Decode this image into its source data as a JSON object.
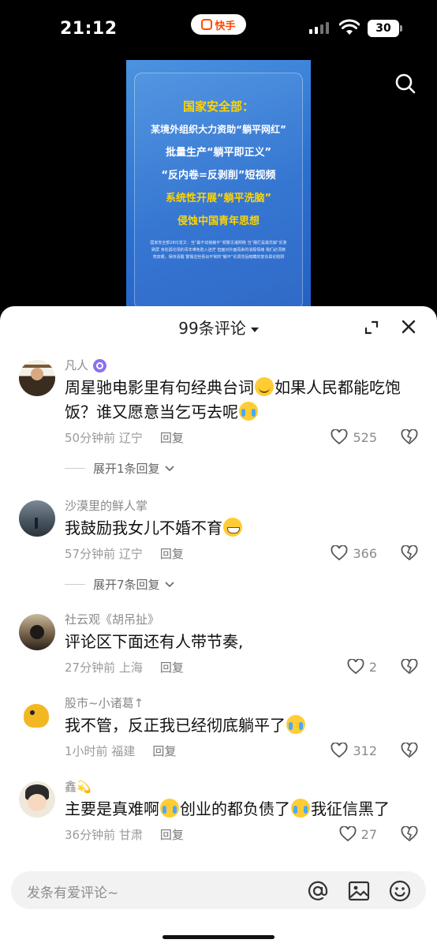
{
  "status_bar": {
    "time": "21:12",
    "app_name": "快手",
    "battery": "30"
  },
  "video": {
    "headline_lines": [
      "国家安全部：",
      "某境外组织大力资助“躺平网红”",
      "批量生产“躺平即正义”",
      "“反内卷=反剥削”短视频",
      "系统性开展“躺平洗脑”",
      "侵蚀中国青年思想"
    ],
    "fine_print": "国家安全部28日发文：当“最不动装躺平”频繁见诸网络 当“摆烂是最优解”反复刷屏 身处舆论场的青年难免陷入迷茫 但面对扑面而来的消极情绪 我们必须擦亮双眼，保持清醒 警惕这些看似平常的“躺平”论调背后暗藏的复杂舆论陷阱"
  },
  "comments_panel": {
    "count_label": "99条评论",
    "comments": [
      {
        "username": "凡人",
        "verified": true,
        "text_parts": [
          "周星驰电影里有句经典台词",
          "😊",
          "如果人民都能吃饱饭？谁又愿意当乞丐去呢",
          "😂"
        ],
        "time": "50分钟前",
        "location": "辽宁",
        "reply_label": "回复",
        "likes": "525",
        "more_replies": "展开1条回复"
      },
      {
        "username": "沙漠里的鲜人掌",
        "text_parts": [
          "我鼓励我女儿不婚不育",
          "😁"
        ],
        "time": "57分钟前",
        "location": "辽宁",
        "reply_label": "回复",
        "likes": "366",
        "more_replies": "展开7条回复"
      },
      {
        "username": "社云观《胡吊扯》",
        "text_parts": [
          "评论区下面还有人带节奏,"
        ],
        "time": "27分钟前",
        "location": "上海",
        "reply_label": "回复",
        "likes": "2"
      },
      {
        "username": "股市~小诸葛↑",
        "text_parts": [
          "我不管，反正我已经彻底躺平了",
          "😂"
        ],
        "time": "1小时前",
        "location": "福建",
        "reply_label": "回复",
        "likes": "312"
      },
      {
        "username": "鑫💫",
        "text_parts": [
          "主要是真难啊",
          "😂",
          "创业的都负债了",
          "😂",
          "我征信黑了"
        ],
        "time": "36分钟前",
        "location": "甘肃",
        "reply_label": "回复",
        "likes": "27"
      }
    ]
  },
  "input": {
    "placeholder": "发条有爱评论~"
  },
  "colors": {
    "brand": "#ff4906",
    "poster_blue": "#2a6fd0",
    "headline_yellow": "#ffd400",
    "badge_purple": "#8c6ff0"
  }
}
